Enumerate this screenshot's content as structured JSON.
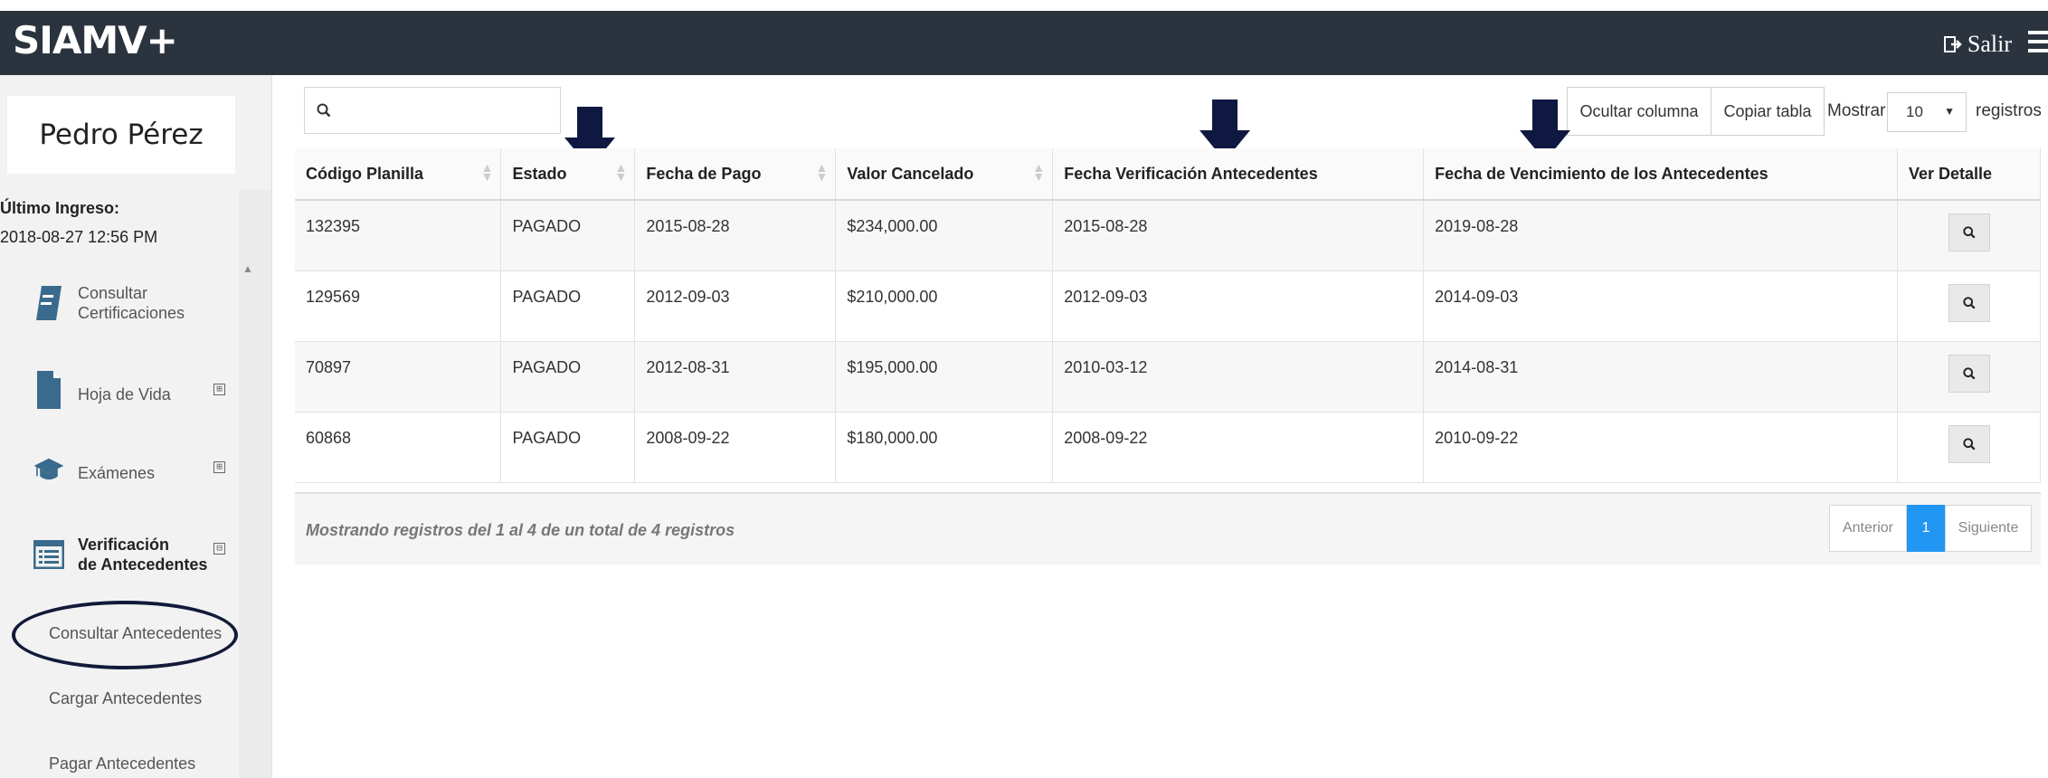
{
  "app": {
    "brand": "SIAMV+",
    "logout_label": "Salir"
  },
  "sidebar": {
    "user_name": "Pedro Pérez",
    "last_login_label": "Último Ingreso:",
    "last_login_value": "2018-08-27 12:56 PM",
    "items": [
      {
        "label_line1": "Consultar",
        "label_line2": "Certificaciones",
        "icon": "book-icon"
      },
      {
        "label": "Hoja de Vida",
        "icon": "document-icon",
        "expander": "⊞"
      },
      {
        "label": "Exámenes",
        "icon": "graduation-cap-icon",
        "expander": "⊞"
      },
      {
        "label_line1": "Verificación",
        "label_line2": "de Antecedentes",
        "icon": "list-icon",
        "expander": "⊟"
      }
    ],
    "subitems": [
      "Consultar Antecedentes",
      "Cargar Antecedentes",
      "Pagar Antecedentes"
    ]
  },
  "toolbar": {
    "search_placeholder": "",
    "hide_column_label": "Ocultar columna",
    "copy_table_label": "Copiar tabla",
    "show_label": "Mostrar",
    "show_value": "10",
    "records_label": "registros"
  },
  "table": {
    "headers": [
      "Código Planilla",
      "Estado",
      "Fecha de Pago",
      "Valor Cancelado",
      "Fecha Verificación Antecedentes",
      "Fecha de Vencimiento de los Antecedentes",
      "Ver Detalle"
    ],
    "rows": [
      [
        "132395",
        "PAGADO",
        "2015-08-28",
        "$234,000.00",
        "2015-08-28",
        "2019-08-28"
      ],
      [
        "129569",
        "PAGADO",
        "2012-09-03",
        "$210,000.00",
        "2012-09-03",
        "2014-09-03"
      ],
      [
        "70897",
        "PAGADO",
        "2012-08-31",
        "$195,000.00",
        "2010-03-12",
        "2014-08-31"
      ],
      [
        "60868",
        "PAGADO",
        "2008-09-22",
        "$180,000.00",
        "2008-09-22",
        "2010-09-22"
      ]
    ]
  },
  "footer": {
    "summary": "Mostrando registros del 1 al 4 de un total de 4 registros",
    "prev_label": "Anterior",
    "page_label": "1",
    "next_label": "Siguiente"
  },
  "colors": {
    "topbar": "#2b343e",
    "accent": "#2196f3",
    "icon": "#3a6b8c",
    "arrow": "#0f1840"
  }
}
